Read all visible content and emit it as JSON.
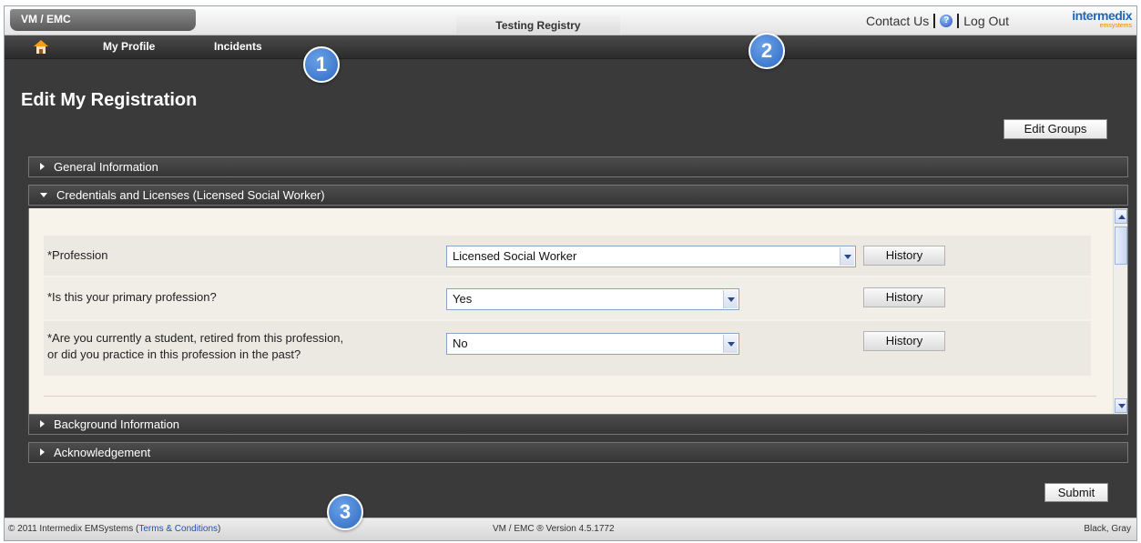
{
  "header": {
    "app_tab": "VM / EMC",
    "center_title": "Testing Registry",
    "contact_us": "Contact Us",
    "help_glyph": "?",
    "log_out": "Log Out",
    "brand_name": "intermedix",
    "brand_sub": "emsystems"
  },
  "nav": {
    "home_icon": "home-icon",
    "items": [
      {
        "label": "My Profile"
      },
      {
        "label": "Incidents"
      }
    ]
  },
  "callouts": [
    "1",
    "2",
    "3"
  ],
  "page": {
    "title": "Edit My Registration",
    "edit_groups": "Edit Groups",
    "submit": "Submit"
  },
  "sections": [
    {
      "label": "General Information",
      "expanded": false
    },
    {
      "label": "Credentials and Licenses (Licensed Social Worker)",
      "expanded": true
    },
    {
      "label": "Background Information",
      "expanded": false
    },
    {
      "label": "Acknowledgement",
      "expanded": false
    }
  ],
  "credentials": {
    "rows": [
      {
        "label": "*Profession",
        "value": "Licensed Social Worker",
        "history": "History"
      },
      {
        "label": "*Is this your primary profession?",
        "value": "Yes",
        "history": "History"
      },
      {
        "label_line1": "*Are you currently a student, retired from this profession,",
        "label_line2": "or did you practice in this profession in the past?",
        "value": "No",
        "history": "History"
      }
    ]
  },
  "footer": {
    "copyright_prefix": "© 2011 Intermedix EMSystems (",
    "terms": "Terms & Conditions",
    "copyright_suffix": ")",
    "version": "VM / EMC ® Version 4.5.1772",
    "theme": "Black, Gray"
  },
  "colors": {
    "accent_blue": "#2f69c2",
    "dark_bg": "#3a3a3a",
    "panel_bg": "#f7f3ea"
  }
}
